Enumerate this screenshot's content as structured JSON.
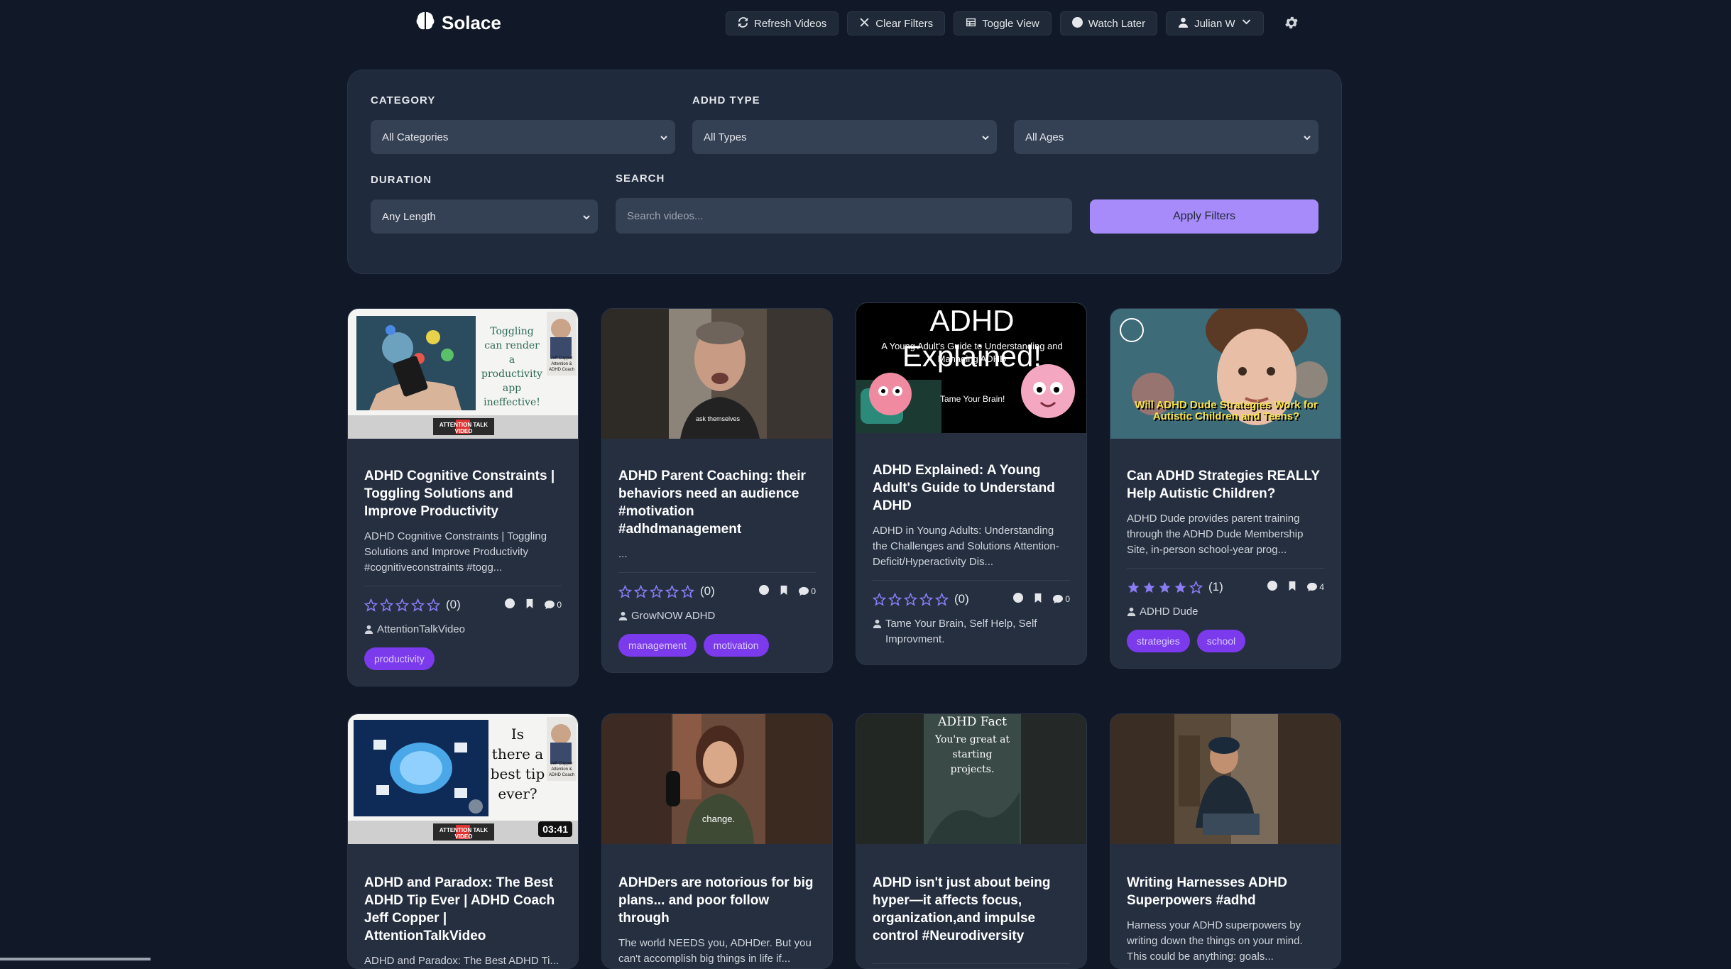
{
  "app": {
    "name": "Solace"
  },
  "nav": {
    "refresh": "Refresh Videos",
    "clear": "Clear Filters",
    "toggle": "Toggle View",
    "watch_later": "Watch Later",
    "user": "Julian W"
  },
  "filters": {
    "category_label": "CATEGORY",
    "category_value": "All Categories",
    "adhd_type_label": "ADHD TYPE",
    "adhd_type_value": "All Types",
    "age_value": "All Ages",
    "duration_label": "DURATION",
    "duration_value": "Any Length",
    "search_label": "SEARCH",
    "search_placeholder": "Search videos...",
    "apply": "Apply Filters"
  },
  "colors": {
    "background": "#111827",
    "panel": "#1f2a3c",
    "card": "#252f40",
    "accent": "#a78bfa",
    "tag": "#7c3aed",
    "star": "#8b7cf6"
  },
  "videos": [
    {
      "title": "ADHD Cognitive Constraints | Toggling Solutions and Improve Productivity",
      "description": "ADHD Cognitive Constraints | Toggling Solutions and Improve Productivity #cognitiveconstraints #togg...",
      "rating": 0,
      "rating_count": "(0)",
      "comments": "0",
      "author": "AttentionTalkVideo",
      "tags": [
        "productivity"
      ],
      "thumb_text": [
        "Toggling",
        "can render",
        "a",
        "productivity",
        "app",
        "ineffective!"
      ],
      "thumb_brand": "ATTENTION TALK VIDEO",
      "thumb_caption": "Jeff Copper Attention & ADHD Coach"
    },
    {
      "title": "ADHD Parent Coaching: their behaviors need an audience #motivation #adhdmanagement",
      "description": "...",
      "rating": 0,
      "rating_count": "(0)",
      "comments": "0",
      "author": "GrowNOW ADHD",
      "tags": [
        "management",
        "motivation"
      ],
      "thumb_text": [
        "ask themselves"
      ]
    },
    {
      "title": "ADHD Explained: A Young Adult's Guide to Understand ADHD",
      "description": "ADHD in Young Adults: Understanding the Challenges and Solutions Attention-Deficit/Hyperactivity Dis...",
      "rating": 0,
      "rating_count": "(0)",
      "comments": "0",
      "author": "Tame Your Brain, Self Help, Self Improvment.",
      "tags": [],
      "thumb_text": [
        "ADHD Explained!",
        "A Young Adult's Guide to Understanding and Managing ADHD",
        "Tame Your Brain!"
      ]
    },
    {
      "title": "Can ADHD Strategies REALLY Help Autistic Children?",
      "description": "ADHD Dude provides parent training through the ADHD Dude Membership Site, in-person school-year prog...",
      "rating": 4,
      "rating_count": "(1)",
      "comments": "4",
      "author": "ADHD Dude",
      "tags": [
        "strategies",
        "school"
      ],
      "thumb_text": [
        "Will ADHD Dude Strategies Work for Autistic Children and Teens?"
      ]
    },
    {
      "title": "ADHD and Paradox: The Best ADHD Tip Ever | ADHD Coach Jeff Copper | AttentionTalkVideo",
      "description": "ADHD and Paradox: The Best ADHD Ti...",
      "duration": "03:41",
      "thumb_text": [
        "Is",
        "there a",
        "best tip",
        "ever?"
      ],
      "thumb_brand": "ATTENTION TALK VIDEO",
      "thumb_caption": "Jeff Copper Attention & ADHD Coach"
    },
    {
      "title": "ADHDers are notorious for big plans... and poor follow through",
      "description": "The world NEEDS you, ADHDer. But you can't accomplish big things in life if...",
      "thumb_text": [
        "change."
      ]
    },
    {
      "title": "ADHD isn't just about being hyper—it affects focus, organization,and impulse control #Neurodiversity",
      "description": "",
      "thumb_text": [
        "ADHD Fact",
        "You're great at",
        "starting",
        "projects."
      ]
    },
    {
      "title": "Writing Harnesses ADHD Superpowers #adhd",
      "description": "Harness your ADHD superpowers by writing down the things on your mind. This could be anything: goals...",
      "thumb_text": []
    }
  ]
}
